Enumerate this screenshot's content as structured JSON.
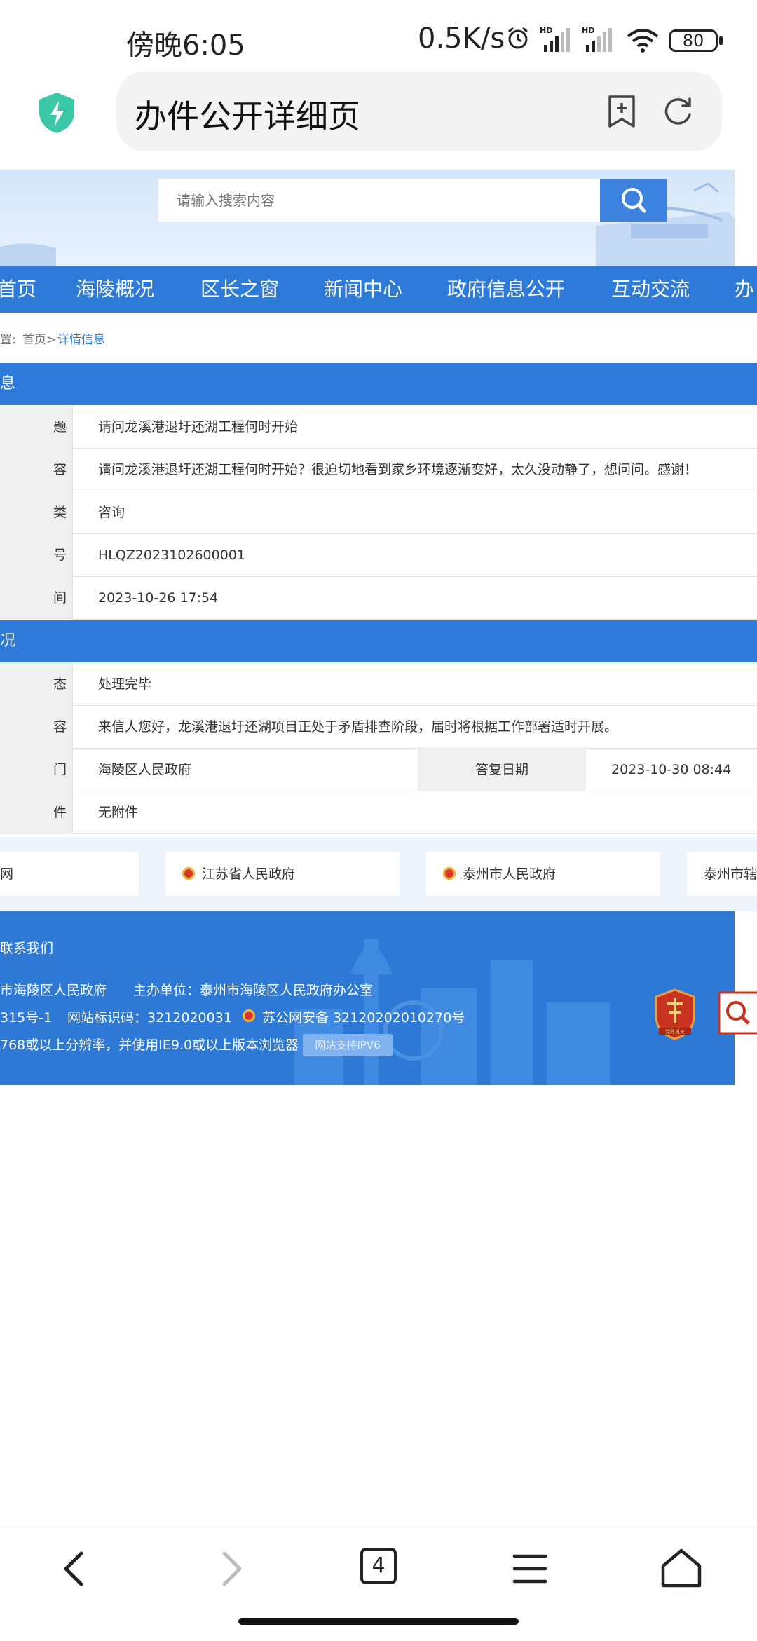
{
  "status_bar": {
    "time": "傍晚6:05",
    "speed": "0.5K/s",
    "battery": "80"
  },
  "browser": {
    "page_title": "办件公开详细页",
    "tab_count": "4"
  },
  "site": {
    "search_placeholder": "请输入搜索内容",
    "nav": [
      "首页",
      "海陵概况",
      "区长之窗",
      "新闻中心",
      "政府信息公开",
      "互动交流",
      "办"
    ],
    "breadcrumb": {
      "prefix": "置:",
      "home": "首页>",
      "current": "详情信息"
    }
  },
  "letter_section": {
    "header": "息",
    "rows": [
      {
        "label": "题",
        "value": "请问龙溪港退圩还湖工程何时开始"
      },
      {
        "label": "容",
        "value": "请问龙溪港退圩还湖工程何时开始？很迫切地看到家乡环境逐渐变好，太久没动静了，想问问。感谢！"
      },
      {
        "label": "类",
        "value": "咨询"
      },
      {
        "label": "号",
        "value": "HLQZ2023102600001"
      },
      {
        "label": "间",
        "value": "2023-10-26 17:54"
      }
    ]
  },
  "reply_section": {
    "header": "况",
    "status": {
      "label": "态",
      "value": "处理完毕"
    },
    "content": {
      "label": "容",
      "value": "来信人您好，龙溪港退圩还湖项目正处于矛盾排查阶段，届时将根据工作部署适时开展。"
    },
    "department": {
      "label": "门",
      "value": "海陵区人民政府",
      "date_label": "答复日期",
      "date_value": "2023-10-30 08:44"
    },
    "attachment": {
      "label": "件",
      "value": "无附件"
    }
  },
  "links": [
    "网",
    "江苏省人民政府",
    "泰州市人民政府",
    "泰州市辖"
  ],
  "footer": {
    "contact": "联系我们",
    "line1_a": "市海陵区人民政府",
    "line1_b": "主办单位：泰州市海陵区人民政府办公室",
    "line2_a": "315号-1",
    "line2_b": "网站标识码：3212020031",
    "line2_c": "苏公网安备 32120202010270号",
    "line3": "768或以上分辨率，并使用IE9.0或以上版本浏览器",
    "ipv6": "网站支持IPV6",
    "badge_text": "党政机关"
  },
  "colors": {
    "primary_blue": "#2e7ad8",
    "search_blue": "#3c82de",
    "label_grey": "#f0f0f0"
  }
}
